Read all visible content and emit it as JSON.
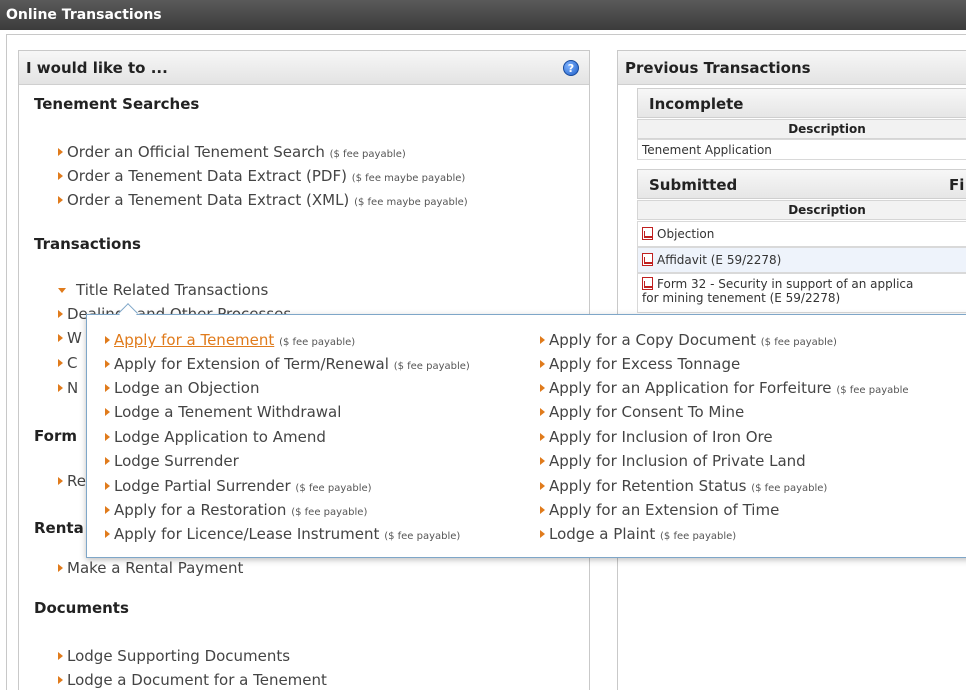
{
  "header": {
    "title": "Online Transactions"
  },
  "left_panel": {
    "title": "I would like to ...",
    "help_icon": "help-icon",
    "sections": {
      "tenement_searches": {
        "title": "Tenement Searches",
        "items": [
          {
            "label": "Order an Official Tenement Search",
            "fee": "($ fee payable)"
          },
          {
            "label": "Order a Tenement Data Extract (PDF)",
            "fee": "($ fee maybe payable)"
          },
          {
            "label": "Order a Tenement Data Extract (XML)",
            "fee": "($ fee maybe payable)"
          }
        ]
      },
      "transactions": {
        "title": "Transactions",
        "expanded_item": "Title Related Transactions",
        "collapsed_items": [
          "Dealings and Other Processes",
          "W",
          "C",
          "N"
        ]
      },
      "forms": {
        "title": "Form",
        "items": [
          "Re"
        ]
      },
      "rental": {
        "title": "Renta",
        "items": [
          "Make a Rental Payment"
        ]
      },
      "documents": {
        "title": "Documents",
        "items": [
          "Lodge Supporting Documents",
          "Lodge a Document for a Tenement"
        ]
      }
    }
  },
  "right_panel": {
    "title": "Previous Transactions",
    "incomplete": {
      "title": "Incomplete",
      "column": "Description",
      "rows": [
        "Tenement Application"
      ]
    },
    "submitted": {
      "title": "Submitted",
      "column_fi": "Fi",
      "column": "Description",
      "rows": [
        "Objection",
        "Affidavit (E 59/2278)",
        "Form 32 - Security in support of an applica",
        "for mining tenement (E 59/2278)"
      ]
    }
  },
  "dropdown": {
    "left_column": [
      {
        "label": "Apply for a Tenement",
        "fee": "($ fee payable)",
        "active": true
      },
      {
        "label": "Apply for Extension of Term/Renewal",
        "fee": "($ fee payable)"
      },
      {
        "label": "Lodge an Objection",
        "fee": ""
      },
      {
        "label": "Lodge a Tenement Withdrawal",
        "fee": ""
      },
      {
        "label": "Lodge Application to Amend",
        "fee": ""
      },
      {
        "label": "Lodge Surrender",
        "fee": ""
      },
      {
        "label": "Lodge Partial Surrender",
        "fee": "($ fee payable)"
      },
      {
        "label": "Apply for a Restoration",
        "fee": "($ fee payable)"
      },
      {
        "label": "Apply for Licence/Lease Instrument",
        "fee": "($ fee payable)"
      }
    ],
    "right_column": [
      {
        "label": "Apply for a Copy Document",
        "fee": "($ fee payable)"
      },
      {
        "label": "Apply for Excess Tonnage",
        "fee": ""
      },
      {
        "label": "Apply for an Application for Forfeiture",
        "fee": "($ fee payable"
      },
      {
        "label": "Apply for Consent To Mine",
        "fee": ""
      },
      {
        "label": "Apply for Inclusion of Iron Ore",
        "fee": ""
      },
      {
        "label": "Apply for Inclusion of Private Land",
        "fee": ""
      },
      {
        "label": "Apply for Retention Status",
        "fee": "($ fee payable)"
      },
      {
        "label": "Apply for an Extension of Time",
        "fee": ""
      },
      {
        "label": "Lodge a Plaint",
        "fee": "($ fee payable)"
      }
    ]
  },
  "colors": {
    "accent": "#e07b1c",
    "topbar": "#4a4a4a",
    "dropdown_border": "#7ea6c8"
  }
}
